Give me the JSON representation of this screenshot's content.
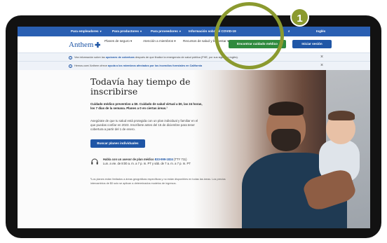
{
  "topbar": {
    "items": [
      {
        "label": "Para empleadores",
        "has_caret": true
      },
      {
        "label": "Para productores",
        "has_caret": true
      },
      {
        "label": "Para proveedores",
        "has_caret": true
      },
      {
        "label": "Información sobre el COVID-19",
        "has_caret": false
      }
    ],
    "search_icon": "search-icon",
    "language_label": "Inglés"
  },
  "header": {
    "logo_text": "Anthem",
    "nav": [
      "Planes de seguro",
      "Atención a miembros",
      "Recursos de salud y bienestar"
    ],
    "find_care_button": "Encontrar cuidado médico",
    "login_button": "Iniciar sesión"
  },
  "notices": [
    {
      "prefix": "Vea información sobre las ",
      "link": "opciones de cobertura",
      "suffix": " después de que finalice la emergencia de salud pública (PHE, por sus siglas en inglés)."
    },
    {
      "prefix": "Hemos.com/ Anthem ofrece ",
      "link": "ayuda a los miembros afectados por los incendios forestales en California",
      "suffix": ""
    }
  ],
  "hero": {
    "title": "Todavía hay tiempo de inscribirse",
    "subtitle": "Cuidado médico preventivo a $0. Cuidado de salud virtual a $0, las 24 horas, los 7 días de la semana. Planes a 0 en ciertas áreas.¹",
    "body": "Asegúrate de que tu salud está protegida con un plan individual y familiar en el que puedas confiar en 2023. Inscríbete antes del 15 de diciembre para tener cobertura a partir del 1 de enero.",
    "button": "Buscar planes individuales",
    "phone_intro": "Habla con un asesor de plan médico",
    "phone_number": "833-999-1824",
    "phone_tty": "(TTY 711)",
    "phone_hours": "Lun. a vie. de 8:00 a. m. a 7 p. m. PT y sáb. de 7 a. m. a 7 p. m. PT",
    "footnote": "¹Los planes están limitados a áreas geográficas específicas y no están disponibles en todas las áreas. Los precios intercambios de $0 solo se aplican a determinados modelos de ingresos."
  },
  "annotation": {
    "number": "1",
    "color": "#8b9a2f"
  },
  "colors": {
    "brand_blue": "#1f56a6",
    "topbar": "#2a5fb2",
    "cta_green": "#2f8a3e"
  }
}
